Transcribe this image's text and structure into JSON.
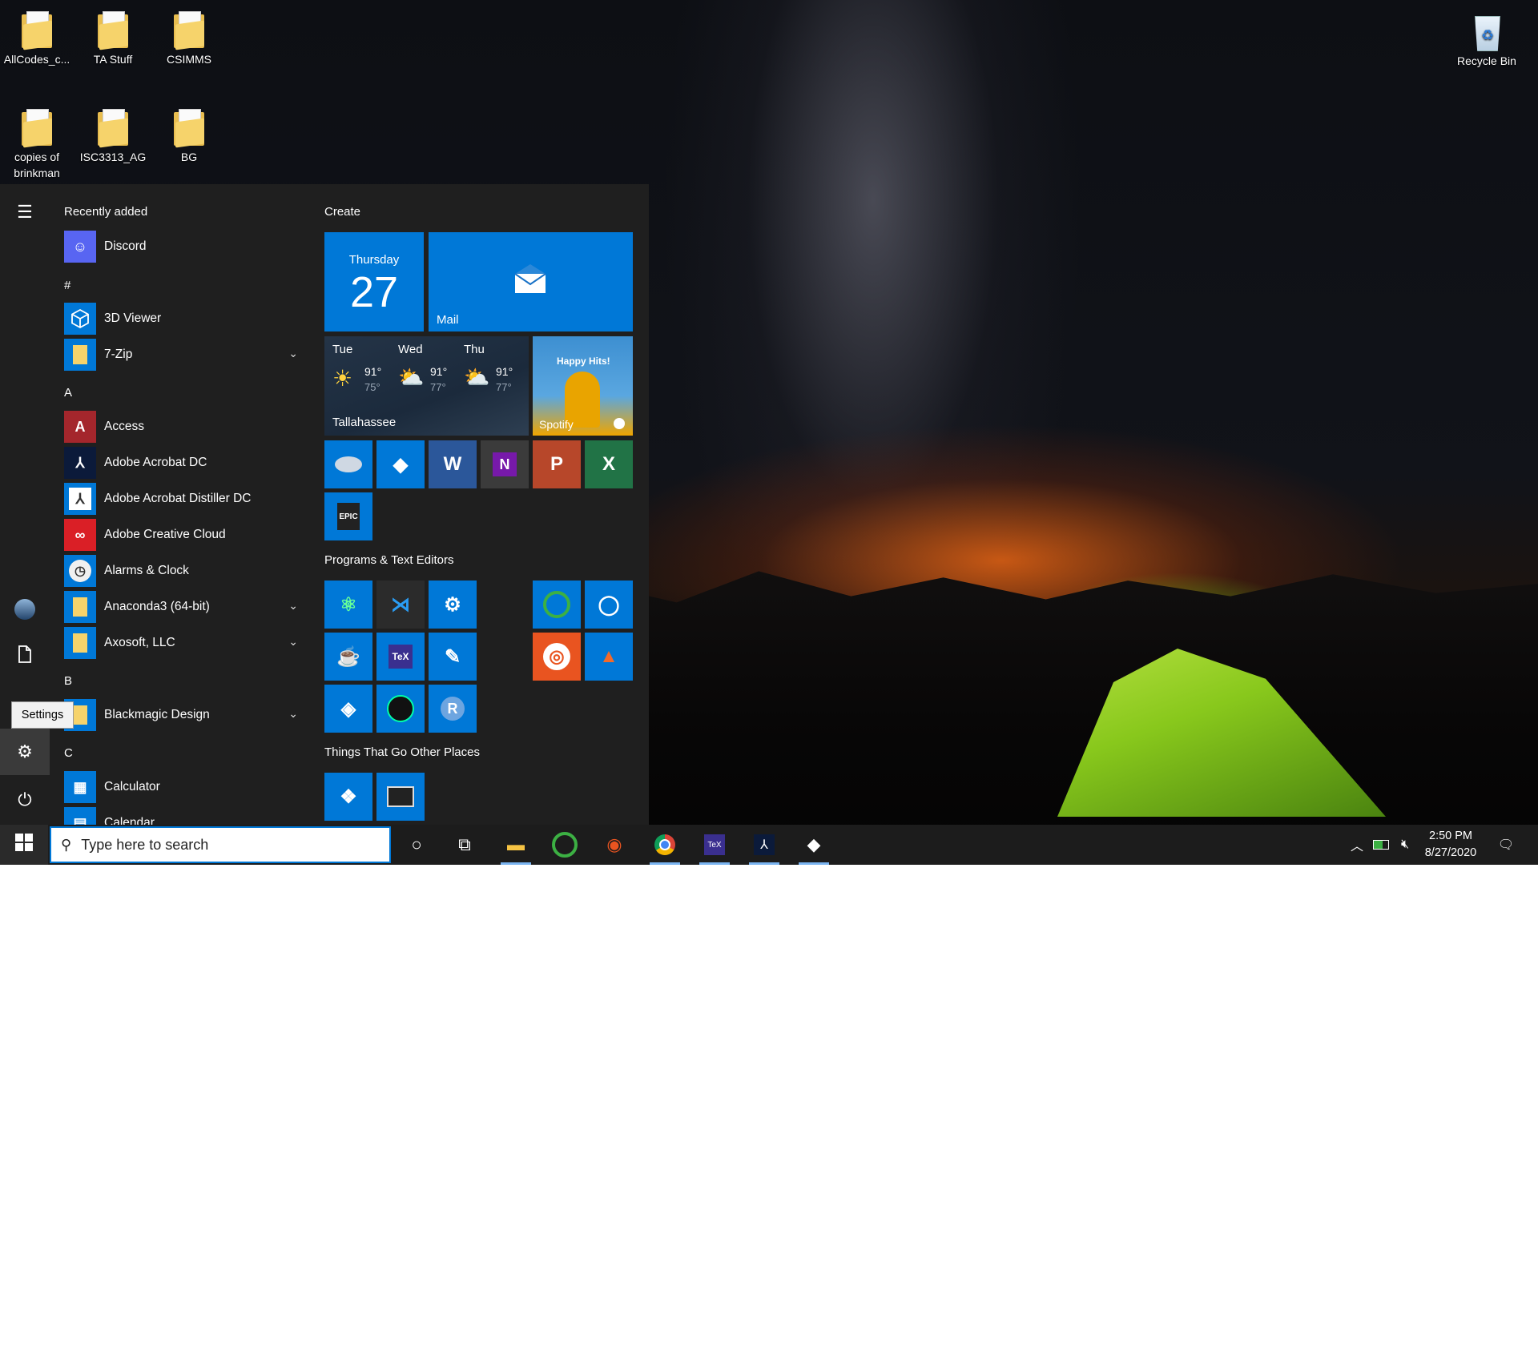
{
  "desktop": {
    "icons": [
      {
        "label": "AllCodes_c...",
        "icon": "folder-icon"
      },
      {
        "label": "TA Stuff",
        "icon": "folder-icon"
      },
      {
        "label": "CSIMMS",
        "icon": "folder-icon"
      },
      {
        "label": "copies of brinkman",
        "icon": "folder-icon"
      },
      {
        "label": "ISC3313_AG",
        "icon": "folder-icon"
      },
      {
        "label": "BG",
        "icon": "folder-icon"
      },
      {
        "label": "Recycle Bin",
        "icon": "recycle-bin-icon"
      }
    ]
  },
  "start_menu": {
    "recently_added_label": "Recently added",
    "apps": [
      {
        "label": "Discord",
        "glyph": "☺",
        "color": "#5865f2"
      },
      {
        "label": "3D Viewer",
        "glyph": "◇",
        "color": "#0078d7"
      },
      {
        "label": "7-Zip",
        "glyph": "",
        "color": "#f6d36b"
      },
      {
        "label": "Access",
        "glyph": "A",
        "color": "#a4262c"
      },
      {
        "label": "Adobe Acrobat DC",
        "glyph": "⅄",
        "color": "#0b1a3a"
      },
      {
        "label": "Adobe Acrobat Distiller DC",
        "glyph": "⅄",
        "color": "#0078d7"
      },
      {
        "label": "Adobe Creative Cloud",
        "glyph": "∞",
        "color": "#da1f26"
      },
      {
        "label": "Alarms & Clock",
        "glyph": "◷",
        "color": "#0078d7"
      },
      {
        "label": "Anaconda3 (64-bit)",
        "glyph": "",
        "color": "#f6d36b"
      },
      {
        "label": "Axosoft, LLC",
        "glyph": "",
        "color": "#f6d36b"
      },
      {
        "label": "Blackmagic Design",
        "glyph": "",
        "color": "#f6d36b"
      },
      {
        "label": "Calculator",
        "glyph": "▦",
        "color": "#0078d7"
      },
      {
        "label": "Calendar",
        "glyph": "▤",
        "color": "#0078d7"
      }
    ],
    "letters": [
      "#",
      "A",
      "B",
      "C"
    ],
    "rail": {
      "menu_icon": "hamburger-icon",
      "settings_tooltip": "Settings"
    },
    "groups": {
      "create": "Create",
      "programs": "Programs & Text Editors",
      "other": "Things That Go Other Places"
    },
    "calendar_tile": {
      "day": "Thursday",
      "date": "27"
    },
    "mail_tile": {
      "label": "Mail"
    },
    "weather_tile": {
      "city": "Tallahassee",
      "days": [
        {
          "name": "Tue",
          "high": "91°",
          "low": "75°",
          "icon": "sun-icon"
        },
        {
          "name": "Wed",
          "high": "91°",
          "low": "77°",
          "icon": "partly-cloudy-icon"
        },
        {
          "name": "Thu",
          "high": "91°",
          "low": "77°",
          "icon": "partly-cloudy-icon"
        }
      ]
    },
    "spotify_tile": {
      "label": "Spotify",
      "headline": "Happy Hits!"
    }
  },
  "taskbar": {
    "search_placeholder": "Type here to search",
    "time": "2:50 PM",
    "date": "8/27/2020"
  }
}
